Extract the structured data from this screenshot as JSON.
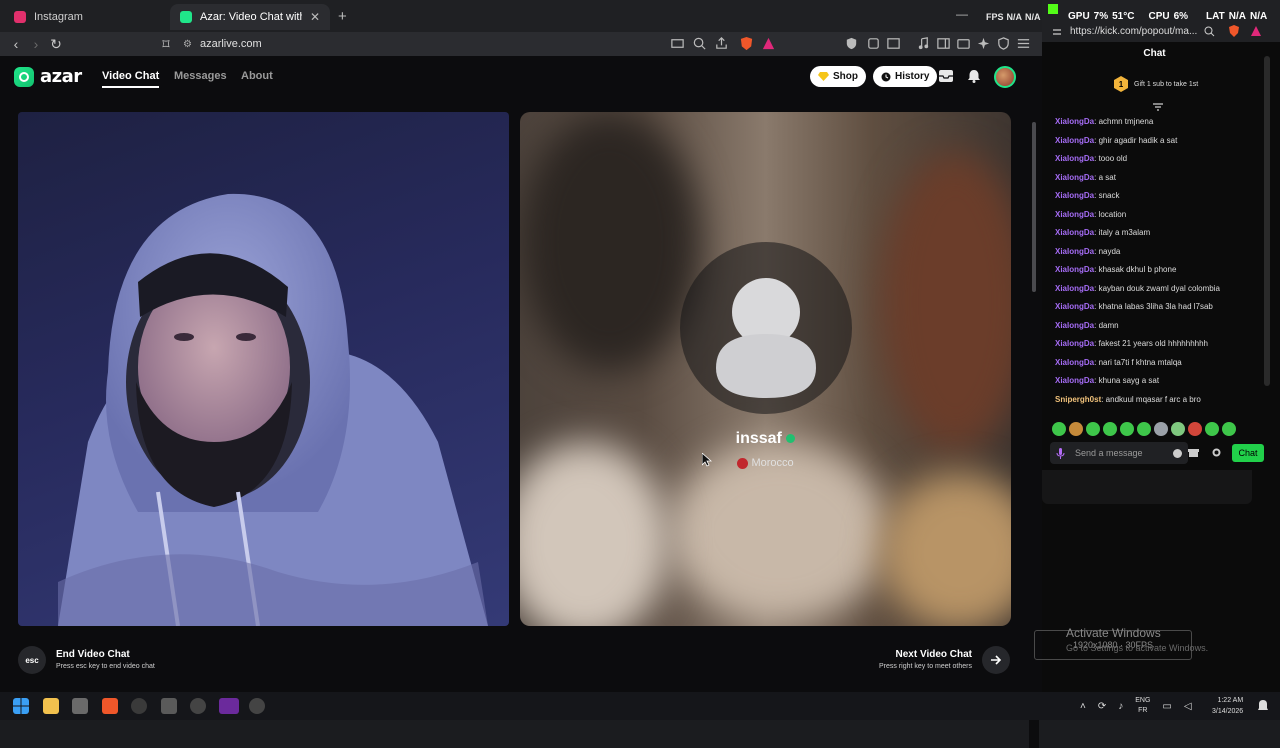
{
  "browser": {
    "tabs": [
      {
        "title": "Instagram",
        "icon": "instagram-icon",
        "color": "#e1306c"
      },
      {
        "title": "Azar: Video Chat with New Pe",
        "icon": "azar-icon",
        "color": "#20e58a"
      }
    ],
    "new_tab": "+",
    "url": "azarlive.com",
    "system_stats": {
      "fps": "FPS",
      "fps_val": "N/A",
      "fps_val2": "N/A",
      "gpu": "GPU",
      "gpu_val": "7%",
      "gpu_temp": "51°C",
      "cpu": "CPU",
      "cpu_val": "6%",
      "lat": "LAT",
      "lat_val": "N/A",
      "lat_val2": "N/A"
    }
  },
  "azar": {
    "logo": "azar",
    "nav": [
      "Video Chat",
      "Messages",
      "About"
    ],
    "shop": "Shop",
    "history": "History",
    "partner": {
      "name": "inssaf",
      "country": "Morocco"
    },
    "end_title": "End Video Chat",
    "end_sub": "Press esc key to end video chat",
    "esc": "esc",
    "next_title": "Next Video Chat",
    "next_sub": "Press right key to meet others",
    "brand_color": "#20e58a"
  },
  "kick": {
    "url": "https://kick.com/popout/ma...",
    "chat_title": "Chat",
    "gift_badge": "1",
    "gift_text": "Gift 1 sub to take 1st",
    "messages": [
      {
        "user": "XialongDa",
        "text": ": achmn tmjnena",
        "color": "#a56cf5"
      },
      {
        "user": "XialongDa",
        "text": ": ghir agadir hadik a sat",
        "color": "#a56cf5"
      },
      {
        "user": "XialongDa",
        "text": ": tooo old",
        "color": "#a56cf5"
      },
      {
        "user": "XialongDa",
        "text": ": a sat",
        "color": "#a56cf5"
      },
      {
        "user": "XialongDa",
        "text": ": snack",
        "color": "#a56cf5"
      },
      {
        "user": "XialongDa",
        "text": ": location",
        "color": "#a56cf5"
      },
      {
        "user": "XialongDa",
        "text": ": italy a m3alam",
        "color": "#a56cf5"
      },
      {
        "user": "XialongDa",
        "text": ": nayda",
        "color": "#a56cf5"
      },
      {
        "user": "XialongDa",
        "text": ": khasak dkhul b phone",
        "color": "#a56cf5"
      },
      {
        "user": "XialongDa",
        "text": ": kayban douk zwaml dyal colombia",
        "color": "#a56cf5"
      },
      {
        "user": "XialongDa",
        "text": ": khatna labas 3liha 3la had l7sab",
        "color": "#a56cf5"
      },
      {
        "user": "XialongDa",
        "text": ": damn",
        "color": "#a56cf5"
      },
      {
        "user": "XialongDa",
        "text": ": fakest 21 years old hhhhhhhhh",
        "color": "#a56cf5"
      },
      {
        "user": "XialongDa",
        "text": ": nari ta7ti f khtna mtalqa",
        "color": "#a56cf5"
      },
      {
        "user": "XialongDa",
        "text": ": khuna sayg a sat",
        "color": "#a56cf5"
      },
      {
        "user": "Snipergh0st",
        "text": ": andkuul mqasar f arc a bro",
        "color": "#f0c27b"
      }
    ],
    "placeholder": "Send a message",
    "chat_button": "Chat",
    "overlay_res": "1920x1080 · 30FPS"
  },
  "windows": {
    "activate_title": "Activate Windows",
    "activate_sub": "Go to Settings to activate Windows.",
    "lang1": "ENG",
    "lang2": "FR",
    "time": "1:22 AM",
    "date": "3/14/2026"
  }
}
